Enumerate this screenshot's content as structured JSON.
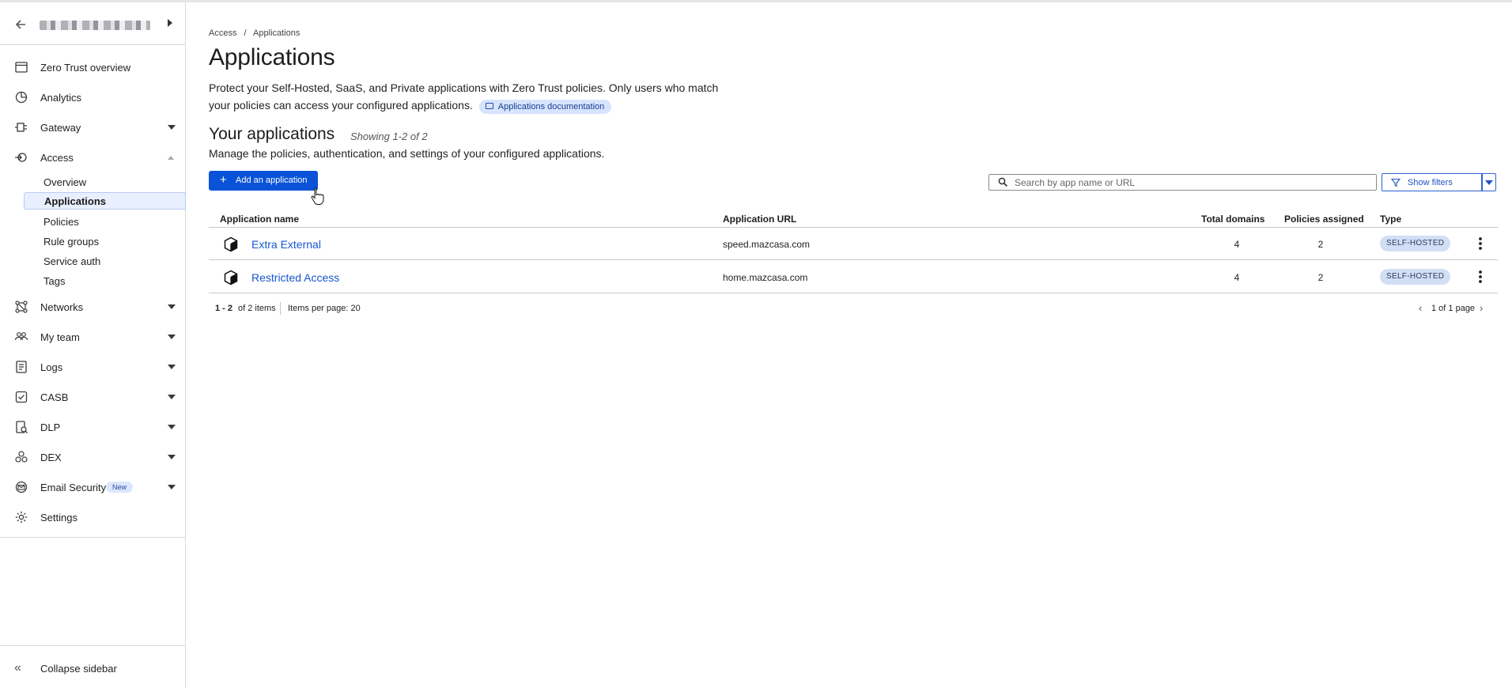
{
  "sidebar": {
    "top_items": [
      {
        "label": "Zero Trust overview",
        "icon": "browser-window-icon"
      },
      {
        "label": "Analytics",
        "icon": "pie-chart-icon"
      },
      {
        "label": "Gateway",
        "icon": "gateway-icon"
      },
      {
        "label": "Access",
        "icon": "access-icon"
      }
    ],
    "access_sub": [
      {
        "label": "Overview"
      },
      {
        "label": "Applications"
      },
      {
        "label": "Policies"
      },
      {
        "label": "Rule groups"
      },
      {
        "label": "Service auth"
      },
      {
        "label": "Tags"
      }
    ],
    "bottom_items": [
      {
        "label": "Networks",
        "icon": "network-icon"
      },
      {
        "label": "My team",
        "icon": "users-icon"
      },
      {
        "label": "Logs",
        "icon": "logs-icon"
      },
      {
        "label": "CASB",
        "icon": "casb-icon"
      },
      {
        "label": "DLP",
        "icon": "dlp-icon"
      },
      {
        "label": "DEX",
        "icon": "dex-icon"
      },
      {
        "label": "Email Security",
        "icon": "email-security-icon",
        "badge": "New"
      },
      {
        "label": "Settings",
        "icon": "gear-icon"
      }
    ],
    "collapse_label": "Collapse sidebar"
  },
  "breadcrumb": {
    "items": [
      "Access",
      "/",
      "Applications"
    ]
  },
  "page": {
    "title": "Applications",
    "description": "Protect your Self-Hosted, SaaS, and Private applications with Zero Trust policies. Only users who match your policies can access your configured applications.",
    "doc_link": "Applications documentation"
  },
  "apps_section": {
    "title": "Your applications",
    "showing": "Showing 1-2 of 2",
    "subtitle": "Manage the policies, authentication, and settings of your configured applications.",
    "add_button": "Add an application",
    "search_placeholder": "Search by app name or URL",
    "filters_button": "Show filters"
  },
  "table": {
    "headers": {
      "name": "Application name",
      "url": "Application URL",
      "domains": "Total domains",
      "policies": "Policies assigned",
      "type": "Type"
    },
    "rows": [
      {
        "name": "Extra External",
        "url": "speed.mazcasa.com",
        "domains": "4",
        "policies": "2",
        "type": "SELF-HOSTED"
      },
      {
        "name": "Restricted Access",
        "url": "home.mazcasa.com",
        "domains": "4",
        "policies": "2",
        "type": "SELF-HOSTED"
      }
    ]
  },
  "pagination": {
    "range": "1 - 2",
    "of_items": "of 2 items",
    "items_per_page": "Items per page: 20",
    "page_info": "1 of 1 page"
  },
  "colors": {
    "primary_button": "#0a53d8",
    "link": "#1656d0",
    "active_nav_bg": "#e8efff",
    "type_badge_bg": "#d2def5"
  }
}
